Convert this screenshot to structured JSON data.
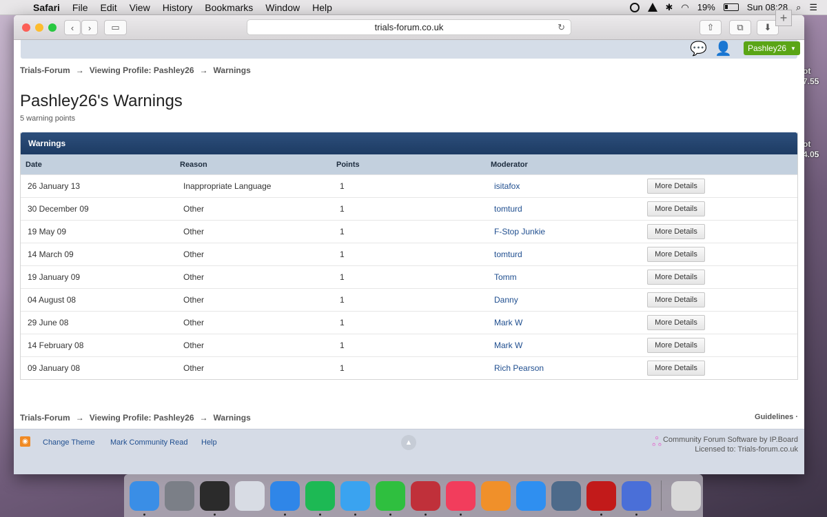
{
  "menubar": {
    "app": "Safari",
    "items": [
      "File",
      "Edit",
      "View",
      "History",
      "Bookmarks",
      "Window",
      "Help"
    ],
    "battery": "19%",
    "clock": "Sun 08:28"
  },
  "desktop": {
    "widget_lines": [
      "ot",
      "7.55",
      "ot",
      "4.05"
    ]
  },
  "browser": {
    "url": "trials-forum.co.uk"
  },
  "userbar": {
    "username": "Pashley26"
  },
  "breadcrumb": {
    "items": [
      "Trials-Forum",
      "Viewing Profile: Pashley26",
      "Warnings"
    ],
    "separator": "→"
  },
  "page": {
    "title": "Pashley26's Warnings",
    "points": "5 warning points",
    "table_title": "Warnings",
    "columns": [
      "Date",
      "Reason",
      "Points",
      "Moderator"
    ],
    "more_label": "More Details",
    "rows": [
      {
        "date": "26 January 13",
        "reason": "Inappropriate Language",
        "points": "1",
        "moderator": "isitafox"
      },
      {
        "date": "30 December 09",
        "reason": "Other",
        "points": "1",
        "moderator": "tomturd"
      },
      {
        "date": "19 May 09",
        "reason": "Other",
        "points": "1",
        "moderator": "F-Stop Junkie"
      },
      {
        "date": "14 March 09",
        "reason": "Other",
        "points": "1",
        "moderator": "tomturd"
      },
      {
        "date": "19 January 09",
        "reason": "Other",
        "points": "1",
        "moderator": "Tomm"
      },
      {
        "date": "04 August 08",
        "reason": "Other",
        "points": "1",
        "moderator": "Danny"
      },
      {
        "date": "29 June 08",
        "reason": "Other",
        "points": "1",
        "moderator": "Mark W"
      },
      {
        "date": "14 February 08",
        "reason": "Other",
        "points": "1",
        "moderator": "Mark W"
      },
      {
        "date": "09 January 08",
        "reason": "Other",
        "points": "1",
        "moderator": "Rich Pearson"
      }
    ],
    "guidelines": "Guidelines ·"
  },
  "footer": {
    "links": [
      "Change Theme",
      "Mark Community Read",
      "Help"
    ],
    "credit_line1": "Community Forum Software by IP.Board",
    "credit_line2": "Licensed to: Trials-forum.co.uk"
  },
  "dock": {
    "apps": [
      {
        "name": "finder",
        "color": "#3a8ee6"
      },
      {
        "name": "launchpad",
        "color": "#7b7f87"
      },
      {
        "name": "dashboard",
        "color": "#2b2b2b"
      },
      {
        "name": "preview",
        "color": "#d8dce4"
      },
      {
        "name": "safari",
        "color": "#2f86e8"
      },
      {
        "name": "spotify",
        "color": "#1db954"
      },
      {
        "name": "messages",
        "color": "#3aa3f0"
      },
      {
        "name": "facetime",
        "color": "#2fbf3f"
      },
      {
        "name": "joystick",
        "color": "#c0303a"
      },
      {
        "name": "itunes",
        "color": "#f23d5c"
      },
      {
        "name": "ibooks",
        "color": "#f0902a"
      },
      {
        "name": "app-store",
        "color": "#2f8ff0"
      },
      {
        "name": "photo-booth",
        "color": "#4d6a8a"
      },
      {
        "name": "flash",
        "color": "#c21a1a"
      },
      {
        "name": "chat",
        "color": "#4a6fd8"
      },
      {
        "name": "trash",
        "color": "#d8d8d8"
      }
    ]
  }
}
